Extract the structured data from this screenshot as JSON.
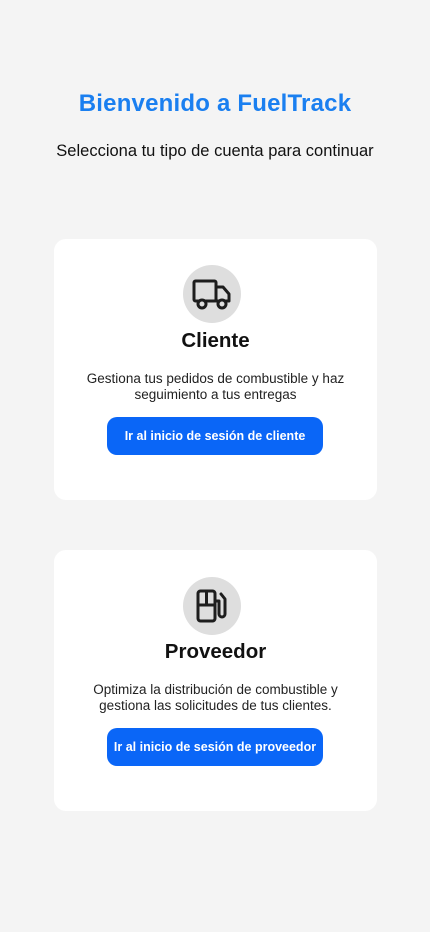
{
  "header": {
    "title": "Bienvenido a FuelTrack",
    "subtitle": "Selecciona tu tipo de cuenta para continuar"
  },
  "cards": [
    {
      "icon": "truck-icon",
      "title": "Cliente",
      "description": "Gestiona tus pedidos de combustible y haz seguimiento a tus entregas",
      "button_label": "Ir al inicio de sesión de cliente"
    },
    {
      "icon": "fuel-pump-icon",
      "title": "Proveedor",
      "description": "Optimiza la distribución de combustible y gestiona las solicitudes de tus clientes.",
      "button_label": "Ir al inicio de sesión de proveedor"
    }
  ],
  "colors": {
    "accent": "#1a7ff0",
    "button": "#0a66f7",
    "background": "#f4f4f4",
    "icon_bg": "#dedede"
  }
}
